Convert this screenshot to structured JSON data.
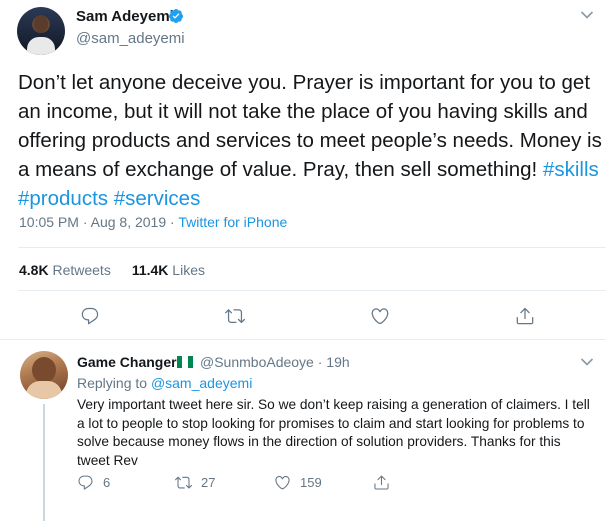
{
  "tweet": {
    "author_name": "Sam Adeyemi",
    "author_handle": "@sam_adeyemi",
    "verified": true,
    "text_parts": [
      "Don’t let anyone deceive you. Prayer is important for you to get an income, but it will not take the place of you having skills and offering products and services to meet people’s needs. Money is a means of exchange of value. Pray, then sell something! "
    ],
    "hashtags": [
      "#skills",
      "#products",
      "#services"
    ],
    "time": "10:05 PM",
    "date_sep": " · ",
    "date": "Aug 8, 2019",
    "source_sep": " · ",
    "source": "Twitter for iPhone",
    "retweets_count": "4.8K",
    "retweets_label": " Retweets",
    "likes_count": "11.4K",
    "likes_label": " Likes"
  },
  "actions": {
    "icons": [
      "reply-icon",
      "retweet-icon",
      "like-icon",
      "share-icon"
    ]
  },
  "reply": {
    "author_name": "Game Changer",
    "flag": "nigeria-flag",
    "handle": "@SunmboAdeoye",
    "time_sep": " · ",
    "time": "19h",
    "replying_prefix": "Replying to ",
    "replying_to": "@sam_adeyemi",
    "text": "Very important tweet here sir. So we don’t keep raising a generation of claimers. I tell a lot to people to stop looking for promises to claim and start looking for problems to solve because money flows in the direction of solution providers. Thanks for this tweet Rev",
    "reply_count": "6",
    "retweet_count": "27",
    "like_count": "159"
  },
  "colors": {
    "link": "#1b95e0",
    "secondary_text": "#657786",
    "divider": "#e6ecf0",
    "nigeria_green": "#008751"
  }
}
